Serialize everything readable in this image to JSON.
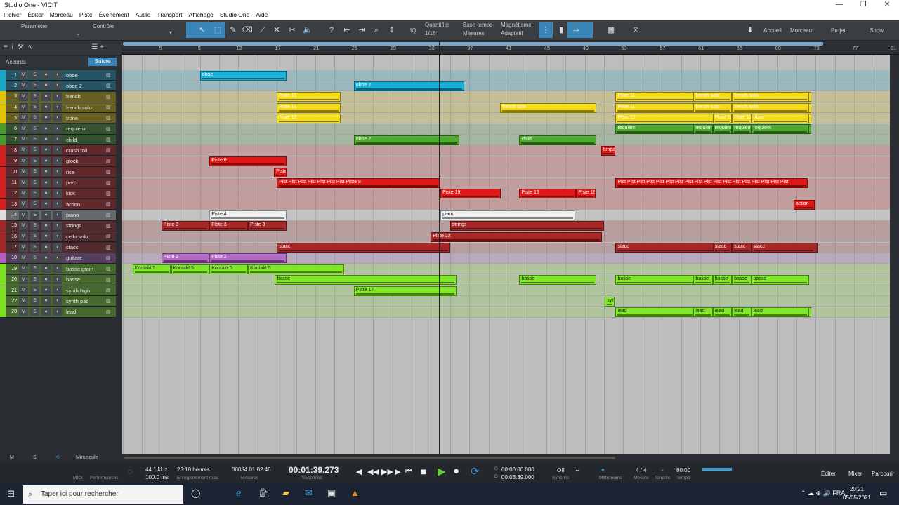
{
  "window": {
    "title": "Studio One - VICIT",
    "controls": [
      "—",
      "❐",
      "✕"
    ]
  },
  "menu": [
    "Fichier",
    "Éditer",
    "Morceau",
    "Piste",
    "Événement",
    "Audio",
    "Transport",
    "Affichage",
    "Studio One",
    "Aide"
  ],
  "toolbar": {
    "param_label": "Paramètre",
    "control_label": "Contrôle",
    "quantize_label": "Quantifier",
    "quantize_value": "1/16",
    "timebase_label": "Base temps",
    "timebase_value": "Mesures",
    "snap_label": "Magnétisme",
    "snap_value": "Adaptatif",
    "home": "Accueil",
    "song": "Morceau",
    "project": "Projet",
    "show": "Show",
    "iq": "IQ"
  },
  "ruler": {
    "bars": [
      "5",
      "9",
      "13",
      "17",
      "21",
      "25",
      "29",
      "33",
      "37",
      "41",
      "45",
      "49",
      "53",
      "57",
      "61",
      "65",
      "69",
      "73",
      "77",
      "81"
    ]
  },
  "leftpanel": {
    "chords_label": "Accords",
    "follow_button": "Suivre",
    "bottom": {
      "m": "M",
      "s": "S",
      "mode": "Minuscule"
    }
  },
  "tracks": [
    {
      "num": "1",
      "name": "oboe",
      "color": "#1aa6c8"
    },
    {
      "num": "2",
      "name": "oboe 2",
      "color": "#1aa6c8"
    },
    {
      "num": "3",
      "name": "french",
      "color": "#e0c400"
    },
    {
      "num": "4",
      "name": "french solo",
      "color": "#e0c400"
    },
    {
      "num": "5",
      "name": "trbne",
      "color": "#e0c400"
    },
    {
      "num": "6",
      "name": "requiem",
      "color": "#4a9c2c"
    },
    {
      "num": "7",
      "name": "child",
      "color": "#4a9c2c"
    },
    {
      "num": "8",
      "name": "crash roll",
      "color": "#d02020"
    },
    {
      "num": "9",
      "name": "glock",
      "color": "#d02020"
    },
    {
      "num": "10",
      "name": "rise",
      "color": "#d02020"
    },
    {
      "num": "11",
      "name": "perc",
      "color": "#d02020"
    },
    {
      "num": "12",
      "name": "kick",
      "color": "#d02020"
    },
    {
      "num": "13",
      "name": "action",
      "color": "#d02020"
    },
    {
      "num": "14",
      "name": "piano",
      "color": "#dddddd"
    },
    {
      "num": "15",
      "name": "strings",
      "color": "#a02828"
    },
    {
      "num": "16",
      "name": "cello solo",
      "color": "#a02828"
    },
    {
      "num": "17",
      "name": "stacc",
      "color": "#a02828"
    },
    {
      "num": "18",
      "name": "guitare",
      "color": "#b060c0"
    },
    {
      "num": "19",
      "name": "basse grain",
      "color": "#7ce020"
    },
    {
      "num": "20",
      "name": "basse",
      "color": "#7ce020"
    },
    {
      "num": "21",
      "name": "synth high",
      "color": "#7ce020"
    },
    {
      "num": "22",
      "name": "synth pad",
      "color": "#7ce020"
    },
    {
      "num": "23",
      "name": "lead",
      "color": "#7ce020"
    }
  ],
  "track_buttons": {
    "m": "M",
    "s": "S"
  },
  "clips": [
    {
      "row": 0,
      "bar": 9,
      "len": 9,
      "label": "oboe",
      "color": "#19b2d8"
    },
    {
      "row": 1,
      "bar": 25,
      "len": 11.5,
      "label": "oboe 2",
      "color": "#19b2d8"
    },
    {
      "row": 2,
      "bar": 17,
      "len": 6.6,
      "label": "Piste 11",
      "color": "#f5dc1a"
    },
    {
      "row": 3,
      "bar": 17,
      "len": 6.6,
      "label": "Piste 11",
      "color": "#f5dc1a"
    },
    {
      "row": 4,
      "bar": 17,
      "len": 6.6,
      "label": "Piste 12",
      "color": "#f5dc1a"
    },
    {
      "row": 3,
      "bar": 40.2,
      "len": 10,
      "label": "french solo",
      "color": "#f5dc1a"
    },
    {
      "row": 2,
      "bar": 52.2,
      "len": 20.3,
      "label": "Piste 11",
      "color": "#f5dc1a"
    },
    {
      "row": 2,
      "bar": 60.3,
      "len": 4,
      "label": "french solo",
      "color": "#f5dc1a"
    },
    {
      "row": 2,
      "bar": 64.3,
      "len": 8,
      "label": "french solo",
      "color": "#f5dc1a"
    },
    {
      "row": 3,
      "bar": 52.2,
      "len": 20.3,
      "label": "Piste 11",
      "color": "#f5dc1a"
    },
    {
      "row": 3,
      "bar": 60.3,
      "len": 4,
      "label": "french solo",
      "color": "#f5dc1a"
    },
    {
      "row": 3,
      "bar": 64.3,
      "len": 8,
      "label": "french solo",
      "color": "#f5dc1a"
    },
    {
      "row": 4,
      "bar": 52.2,
      "len": 20.3,
      "label": "Piste 12",
      "color": "#f5dc1a"
    },
    {
      "row": 4,
      "bar": 62.3,
      "len": 2,
      "label": "Piste 12",
      "color": "#f5dc1a"
    },
    {
      "row": 4,
      "bar": 64.3,
      "len": 2,
      "label": "Piste 12",
      "color": "#f5dc1a"
    },
    {
      "row": 4,
      "bar": 66.3,
      "len": 6,
      "label": "trbne",
      "color": "#f5dc1a"
    },
    {
      "row": 5,
      "bar": 52.2,
      "len": 20.3,
      "label": "requiem",
      "color": "#4eaa30"
    },
    {
      "row": 5,
      "bar": 60.3,
      "len": 2,
      "label": "requiem",
      "color": "#4eaa30"
    },
    {
      "row": 5,
      "bar": 62.3,
      "len": 2,
      "label": "requiem",
      "color": "#4eaa30"
    },
    {
      "row": 5,
      "bar": 64.3,
      "len": 2,
      "label": "requiem",
      "color": "#4eaa30"
    },
    {
      "row": 5,
      "bar": 66.3,
      "len": 6,
      "label": "requiem",
      "color": "#4eaa30"
    },
    {
      "row": 6,
      "bar": 25,
      "len": 11,
      "label": "oboe 2",
      "color": "#4eaa30"
    },
    {
      "row": 6,
      "bar": 42.2,
      "len": 8,
      "label": "child",
      "color": "#4eaa30"
    },
    {
      "row": 7,
      "bar": 50.7,
      "len": 1.5,
      "label": "timpa",
      "color": "#e01818"
    },
    {
      "row": 8,
      "bar": 10,
      "len": 8,
      "label": "Piste 6",
      "color": "#e01818"
    },
    {
      "row": 9,
      "bar": 16.7,
      "len": 1.3,
      "label": "Piste",
      "color": "#e01818"
    },
    {
      "row": 10,
      "bar": 17,
      "len": 17,
      "label": "Pist Pist Pist Pist Pist Pist Pist Piste 9",
      "color": "#e01818"
    },
    {
      "row": 10,
      "bar": 52.2,
      "len": 20,
      "label": "Pist Pist Pist Pist Pist Pist Pist Pist Pist Pist Pist Pist Pist Pist Pist Pist Pist Pist",
      "color": "#e01818"
    },
    {
      "row": 11,
      "bar": 34,
      "len": 6.3,
      "label": "Piste 19",
      "color": "#e01818"
    },
    {
      "row": 11,
      "bar": 42.2,
      "len": 5.9,
      "label": "Piste 19",
      "color": "#e01818"
    },
    {
      "row": 11,
      "bar": 48.1,
      "len": 2,
      "label": "Piste 19",
      "color": "#e01818"
    },
    {
      "row": 12,
      "bar": 70.7,
      "len": 2.2,
      "label": "action",
      "color": "#e01818"
    },
    {
      "row": 13,
      "bar": 10,
      "len": 8,
      "label": "Piste 4",
      "color": "#eeeeee",
      "dark": true
    },
    {
      "row": 13,
      "bar": 34,
      "len": 14,
      "label": "piano",
      "color": "#eeeeee",
      "dark": true
    },
    {
      "row": 14,
      "bar": 5,
      "len": 5,
      "label": "Piste 3",
      "color": "#a82828"
    },
    {
      "row": 14,
      "bar": 10,
      "len": 4,
      "label": "Piste 3",
      "color": "#a82828"
    },
    {
      "row": 14,
      "bar": 14,
      "len": 4,
      "label": "Piste 3",
      "color": "#a82828"
    },
    {
      "row": 14,
      "bar": 35,
      "len": 16,
      "label": "strings",
      "color": "#a82828"
    },
    {
      "row": 15,
      "bar": 33,
      "len": 17.8,
      "label": "Piste 22",
      "color": "#a82828"
    },
    {
      "row": 16,
      "bar": 17,
      "len": 18,
      "label": "stacc",
      "color": "#a82828"
    },
    {
      "row": 16,
      "bar": 52.2,
      "len": 21,
      "label": "stacc",
      "color": "#a82828"
    },
    {
      "row": 16,
      "bar": 62.3,
      "len": 2,
      "label": "stacc",
      "color": "#a82828"
    },
    {
      "row": 16,
      "bar": 64.3,
      "len": 2,
      "label": "stacc",
      "color": "#a82828"
    },
    {
      "row": 16,
      "bar": 66.3,
      "len": 6.7,
      "label": "stacc",
      "color": "#a82828"
    },
    {
      "row": 17,
      "bar": 5,
      "len": 5,
      "label": "Piste 2",
      "color": "#b468c8"
    },
    {
      "row": 17,
      "bar": 10,
      "len": 8,
      "label": "Piste 2",
      "color": "#b468c8"
    },
    {
      "row": 18,
      "bar": 2,
      "len": 4,
      "label": "Kontakt 5",
      "color": "#80e828",
      "dark": true
    },
    {
      "row": 18,
      "bar": 6,
      "len": 4,
      "label": "Kontakt 5",
      "color": "#80e828",
      "dark": true
    },
    {
      "row": 18,
      "bar": 10,
      "len": 4,
      "label": "Kontakt 5",
      "color": "#80e828",
      "dark": true
    },
    {
      "row": 18,
      "bar": 14,
      "len": 10,
      "label": "Kontakt 5",
      "color": "#80e828",
      "dark": true
    },
    {
      "row": 19,
      "bar": 16.8,
      "len": 18.9,
      "label": "basse",
      "color": "#80e828",
      "dark": true
    },
    {
      "row": 19,
      "bar": 42.2,
      "len": 8,
      "label": "basse",
      "color": "#80e828",
      "dark": true
    },
    {
      "row": 19,
      "bar": 52.2,
      "len": 20,
      "label": "basse",
      "color": "#80e828",
      "dark": true
    },
    {
      "row": 19,
      "bar": 60.3,
      "len": 2,
      "label": "basse",
      "color": "#80e828",
      "dark": true
    },
    {
      "row": 19,
      "bar": 62.3,
      "len": 2,
      "label": "basse",
      "color": "#80e828",
      "dark": true
    },
    {
      "row": 19,
      "bar": 64.3,
      "len": 2,
      "label": "basse",
      "color": "#80e828",
      "dark": true
    },
    {
      "row": 19,
      "bar": 66.3,
      "len": 6,
      "label": "basse",
      "color": "#80e828",
      "dark": true
    },
    {
      "row": 20,
      "bar": 25,
      "len": 10.7,
      "label": "Piste 17",
      "color": "#80e828",
      "dark": true
    },
    {
      "row": 21,
      "bar": 51.1,
      "len": 1,
      "label": "syn",
      "color": "#80e828",
      "dark": true
    },
    {
      "row": 22,
      "bar": 52.2,
      "len": 20.3,
      "label": "lead",
      "color": "#80e828",
      "dark": true
    },
    {
      "row": 22,
      "bar": 60.3,
      "len": 2,
      "label": "lead",
      "color": "#80e828",
      "dark": true
    },
    {
      "row": 22,
      "bar": 62.3,
      "len": 2,
      "label": "lead",
      "color": "#80e828",
      "dark": true
    },
    {
      "row": 22,
      "bar": 64.3,
      "len": 2,
      "label": "lead",
      "color": "#80e828",
      "dark": true
    },
    {
      "row": 22,
      "bar": 66.3,
      "len": 6,
      "label": "lead",
      "color": "#80e828",
      "dark": true
    }
  ],
  "transport": {
    "midi": "MIDI",
    "perf": "Performances",
    "samplerate": "44.1 kHz",
    "latency": "100.0 ms",
    "rec_time": "23:10 heures",
    "rec_max": "Enregistrement max.",
    "bars_pos": "00034.01.02.46",
    "bars_label": "Mesures",
    "time": "00:01:39.273",
    "seconds_label": "Secondes",
    "loop_g": "00:00:00.000",
    "loop_d": "00:03:39.000",
    "sync_val": "Off",
    "sync": "Synchro",
    "metronome": "Métronome",
    "signature": "4 / 4",
    "measure": "Mesure",
    "key": "-",
    "tonality": "Tonalité",
    "tempo_val": "80.00",
    "tempo": "Tempo",
    "edit": "Éditer",
    "mixer": "Mixer",
    "browse": "Parcourir",
    "g": "G",
    "d": "D"
  },
  "taskbar": {
    "search_placeholder": "Taper ici pour rechercher",
    "time": "20:21",
    "date": "05/05/2021"
  }
}
